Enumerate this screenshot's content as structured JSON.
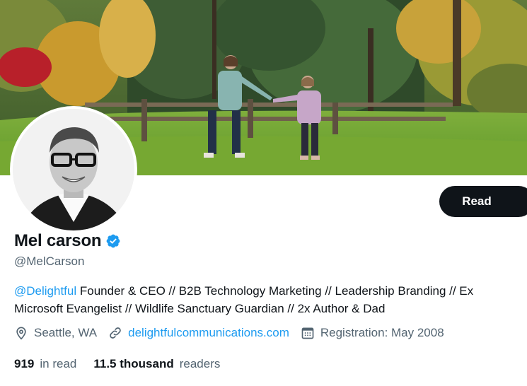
{
  "profile": {
    "display_name": "Mel carson",
    "handle": "@MelCarson",
    "bio_mention": "@Delightful",
    "bio_text": " Founder & CEO // B2B Technology Marketing // Leadership Branding // Ex Microsoft Evangelist // Wildlife Sanctuary Guardian // 2x Author & Dad",
    "location": "Seattle, WA",
    "website": "delightfulcommunications.com",
    "joined": "Registration: May 2008"
  },
  "actions": {
    "read_label": "Read"
  },
  "stats": {
    "following_count": "919",
    "following_label": "in read",
    "followers_count": "11.5 thousand",
    "followers_label": "readers"
  },
  "icons": {
    "verified": "verified-badge-icon",
    "location": "location-pin-icon",
    "link": "link-icon",
    "calendar": "calendar-icon"
  },
  "colors": {
    "accent": "#1d9bf0",
    "text_primary": "#0f1419",
    "text_secondary": "#536471",
    "button_bg": "#0f1419"
  }
}
